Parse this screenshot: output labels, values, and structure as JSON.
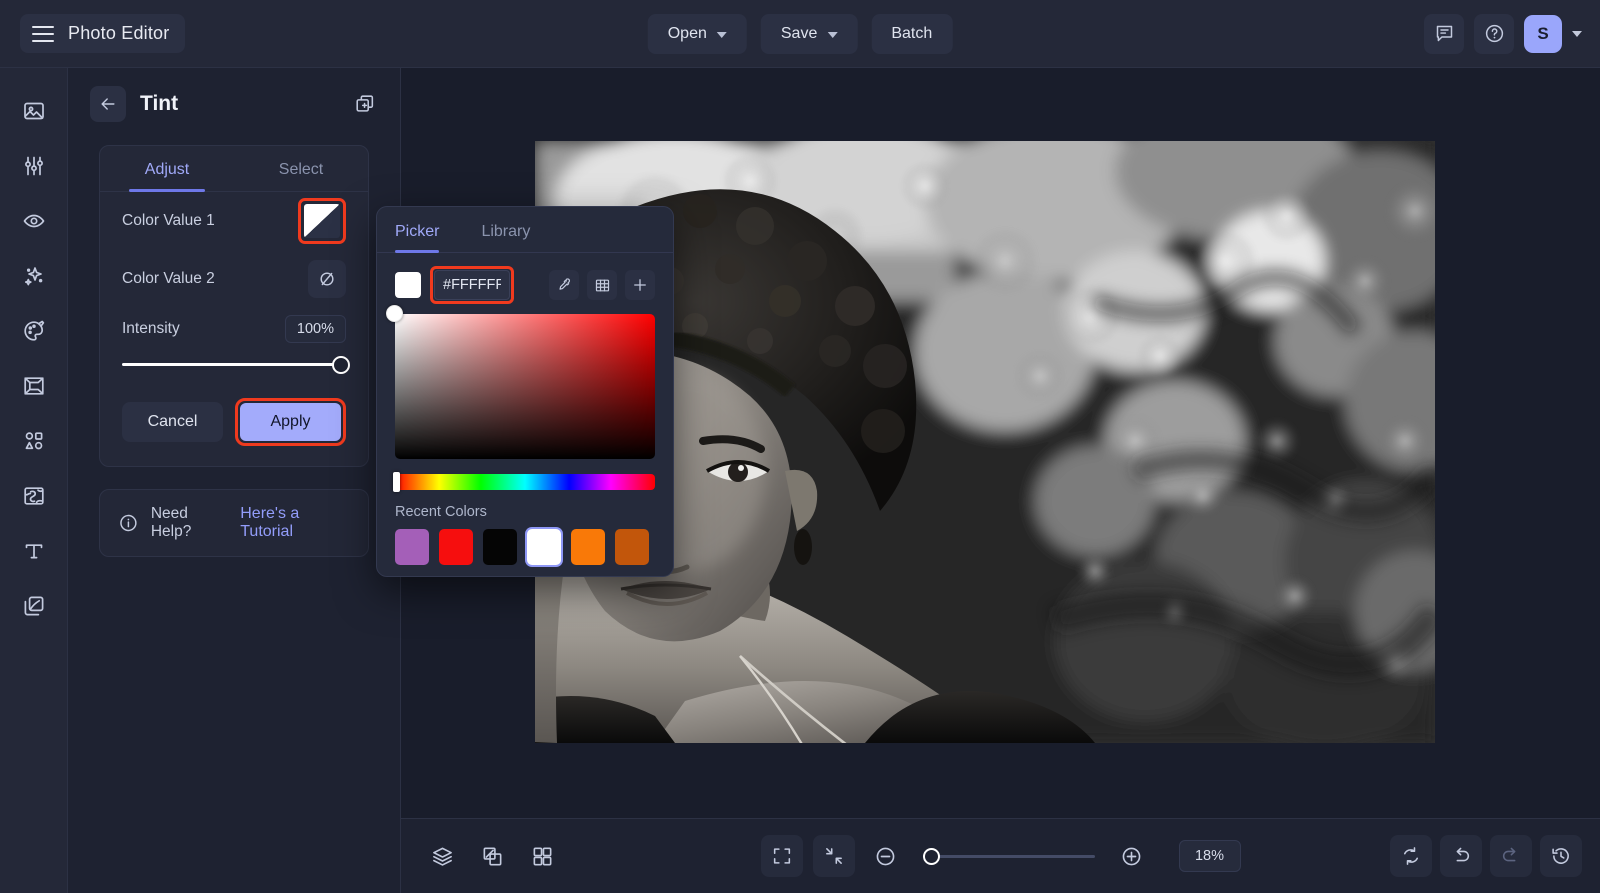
{
  "app": {
    "title": "Photo Editor"
  },
  "topbar": {
    "menu_icon": "hamburger-icon",
    "open_label": "Open",
    "save_label": "Save",
    "batch_label": "Batch",
    "feedback_icon": "comment-icon",
    "help_icon": "question-circle-icon",
    "avatar_initial": "S",
    "accent": "#9aa6fb"
  },
  "sidebar": {
    "items": [
      {
        "name": "image",
        "icon": "image-icon",
        "active": false
      },
      {
        "name": "adjust",
        "icon": "sliders-icon",
        "active": true
      },
      {
        "name": "retouch",
        "icon": "eye-icon",
        "active": false
      },
      {
        "name": "effects",
        "icon": "sparkles-icon",
        "active": false
      },
      {
        "name": "color",
        "icon": "palette-icon",
        "active": false
      },
      {
        "name": "frame",
        "icon": "frame-icon",
        "active": false
      },
      {
        "name": "shapes",
        "icon": "shapes-icon",
        "active": false
      },
      {
        "name": "texture",
        "icon": "texture-icon",
        "active": false
      },
      {
        "name": "text",
        "icon": "text-icon",
        "active": false
      },
      {
        "name": "overlay",
        "icon": "overlay-icon",
        "active": false
      }
    ]
  },
  "panel": {
    "back_icon": "arrow-left-icon",
    "title": "Tint",
    "duplicate_icon": "duplicate-icon",
    "tabs": [
      {
        "label": "Adjust",
        "active": true
      },
      {
        "label": "Select",
        "active": false
      }
    ],
    "color_value_1": {
      "label": "Color Value 1",
      "swatch_color": "#FFFFFF",
      "highlighted": true,
      "highlight_color": "#f03a1e"
    },
    "color_value_2": {
      "label": "Color Value 2",
      "icon": "no-color-icon",
      "value": "none"
    },
    "intensity": {
      "label": "Intensity",
      "value": "100%",
      "percent": 100
    },
    "cancel_label": "Cancel",
    "apply_label": "Apply",
    "apply_highlighted": true,
    "help": {
      "icon": "info-icon",
      "text": "Need Help?",
      "link": "Here's a Tutorial"
    }
  },
  "picker": {
    "tabs": [
      {
        "label": "Picker",
        "active": true
      },
      {
        "label": "Library",
        "active": false
      }
    ],
    "current_color": "#FFFFFF",
    "hex_value": "#FFFFFF",
    "hex_highlighted": true,
    "tools": [
      {
        "name": "eyedropper-icon"
      },
      {
        "name": "grid-icon"
      },
      {
        "name": "add-icon"
      }
    ],
    "sv_knob": {
      "x_percent": 0,
      "y_percent": 0
    },
    "hue_percent": 0,
    "recent_label": "Recent Colors",
    "recent_colors": [
      {
        "hex": "#A45FB8",
        "selected": false
      },
      {
        "hex": "#F60E0E",
        "selected": false
      },
      {
        "hex": "#050505",
        "selected": false
      },
      {
        "hex": "#FFFFFF",
        "selected": true
      },
      {
        "hex": "#F97908",
        "selected": false
      },
      {
        "hex": "#C2560B",
        "selected": false
      }
    ]
  },
  "canvas": {
    "photo_alt": "black and white portrait of a woman with curly hair resting her hand on her head in front of blurred foliage"
  },
  "bottombar": {
    "left_tools": [
      {
        "name": "layers-icon"
      },
      {
        "name": "compare-icon"
      },
      {
        "name": "grid-view-icon"
      }
    ],
    "fit_icon": "fit-screen-icon",
    "shrink_icon": "shrink-icon",
    "zoom_out_icon": "zoom-out-icon",
    "zoom_in_icon": "zoom-in-icon",
    "zoom_value": "18%",
    "zoom_percent": 3,
    "right_tools": [
      {
        "name": "reset-icon",
        "disabled": false
      },
      {
        "name": "undo-icon",
        "disabled": false
      },
      {
        "name": "redo-icon",
        "disabled": true
      },
      {
        "name": "history-icon",
        "disabled": false
      }
    ]
  }
}
